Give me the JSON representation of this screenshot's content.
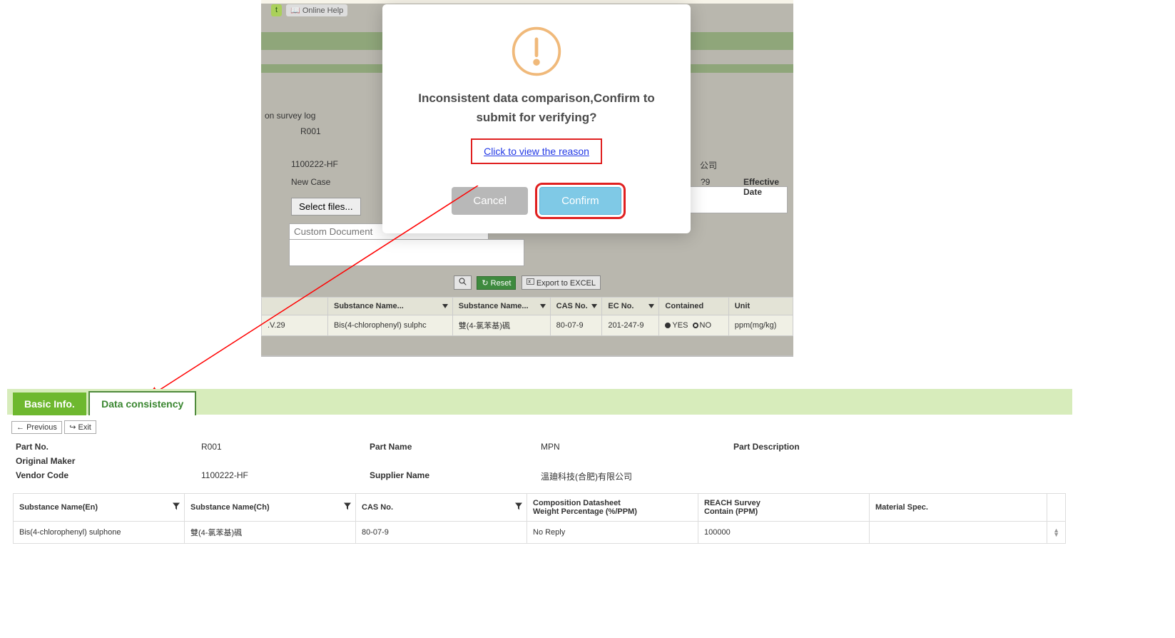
{
  "toolbar": {
    "online_help": "Online Help"
  },
  "back_form": {
    "survey_log_label": "on survey log",
    "r001": "R001",
    "code": "1100222-HF",
    "status": "New Case",
    "select_files": "Select files...",
    "custom_doc_placeholder": "Custom Document",
    "company_suffix": "公司",
    "date_suffix": "?9",
    "effective_date_label": "Effective Date",
    "version_cell": ".V.29",
    "search_label": "",
    "reset_label": "Reset",
    "export_label": "Export to EXCEL"
  },
  "back_table": {
    "headers": [
      "Substance Name...",
      "Substance Name...",
      "CAS No.",
      "EC No.",
      "Contained",
      "Unit"
    ],
    "row": {
      "en": "Bis(4-chlorophenyl) sulphc",
      "ch": "雙(4-氯苯基)碸",
      "cas": "80-07-9",
      "ec": "201-247-9",
      "yes": "YES",
      "no": "NO",
      "unit": "ppm(mg/kg)"
    }
  },
  "modal": {
    "title": "Inconsistent data comparison,Confirm to submit for verifying?",
    "link": "Click to view the reason",
    "cancel": "Cancel",
    "confirm": "Confirm"
  },
  "tabs": {
    "basic": "Basic Info.",
    "data_consistency": "Data consistency"
  },
  "nav": {
    "previous": "Previous",
    "exit": "Exit"
  },
  "details": {
    "part_no_label": "Part No.",
    "part_no": "R001",
    "part_name_label": "Part Name",
    "part_name": "MPN",
    "part_desc_label": "Part Description",
    "orig_maker_label": "Original Maker",
    "vendor_code_label": "Vendor Code",
    "vendor_code": "1100222-HF",
    "supplier_name_label": "Supplier Name",
    "supplier_name": "溫廸科技(合肥)有限公司"
  },
  "main_table": {
    "headers": {
      "en": "Substance Name(En)",
      "ch": "Substance Name(Ch)",
      "cas": "CAS No.",
      "comp_line1": "Composition Datasheet",
      "comp_line2": "Weight Percentage (%/PPM)",
      "reach_line1": "REACH Survey",
      "reach_line2": "Contain (PPM)",
      "spec": "Material Spec."
    },
    "row": {
      "en": "Bis(4-chlorophenyl) sulphone",
      "ch": "雙(4-氯苯基)碸",
      "cas": "80-07-9",
      "comp": "No Reply",
      "reach": "100000",
      "spec": ""
    }
  },
  "colors": {
    "highlight_red": "#e02020",
    "link_blue": "#2339e6",
    "confirm_blue": "#7fc9e6",
    "tab_green": "#6eb82f"
  }
}
